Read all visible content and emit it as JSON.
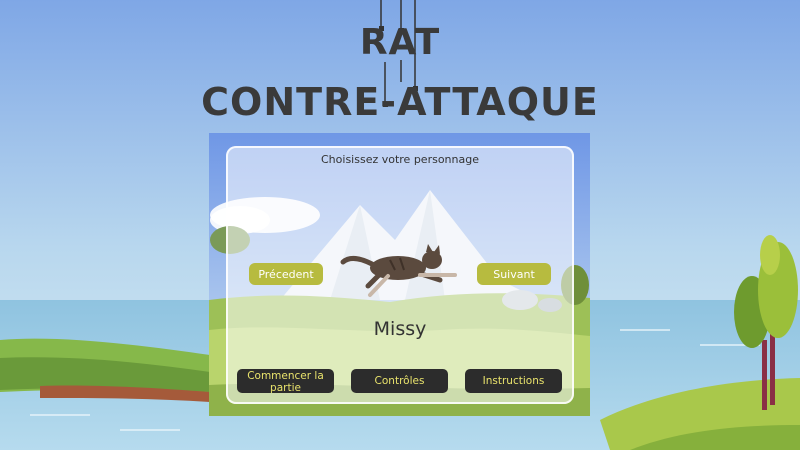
{
  "game": {
    "title_line1": "RAT",
    "title_line2": "CONTRE-ATTAQUE"
  },
  "menu": {
    "heading": "Choisissez votre personnage",
    "prev_label": "Précedent",
    "next_label": "Suivant",
    "character_name": "Missy",
    "start_label": "Commencer la partie",
    "controls_label": "Contrôles",
    "instructions_label": "Instructions"
  },
  "colors": {
    "button_olive": "#b7bb3f",
    "button_dark": "#2c2c2c",
    "button_dark_text": "#e9e36c",
    "title_text": "#3a3a3a"
  },
  "icons": {
    "character": "running-cat"
  }
}
